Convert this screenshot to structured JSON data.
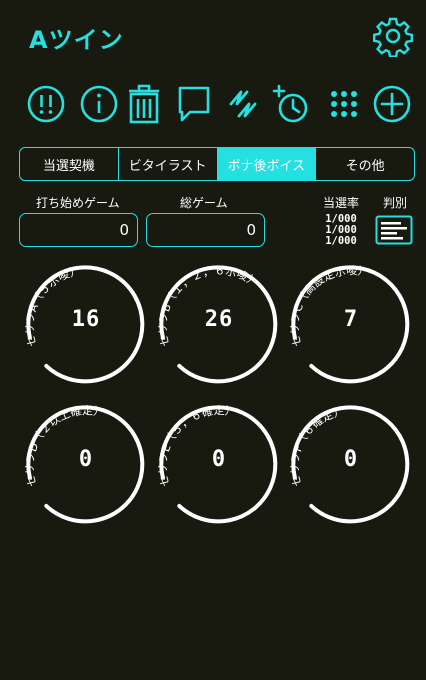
{
  "app": {
    "title": "Aツイン"
  },
  "theme": {
    "accent": "#24e0e0",
    "background": "#18190f",
    "text": "#ffffff"
  },
  "toolbar": {
    "icons": [
      "alert-icon",
      "info-icon",
      "trash-icon",
      "comment-icon",
      "lightning-icon",
      "timer-add-icon",
      "grid-icon",
      "plus-icon"
    ]
  },
  "tabs": [
    {
      "label": "当選契機",
      "active": false
    },
    {
      "label": "ビタイラスト",
      "active": false
    },
    {
      "label": "ボナ後ボイス",
      "active": true
    },
    {
      "label": "その他",
      "active": false
    }
  ],
  "inputs": {
    "start_game": {
      "label": "打ち始めゲーム",
      "value": "0"
    },
    "total_game": {
      "label": "総ゲーム",
      "value": "0"
    }
  },
  "stats": {
    "rate_label": "当選率",
    "rates": [
      "1/000",
      "1/000",
      "1/000"
    ],
    "judge_label": "判別"
  },
  "counters": [
    {
      "label": "セリフA（５示唆）",
      "value": "16"
    },
    {
      "label": "セリフB（１，２，６示唆）",
      "value": "26"
    },
    {
      "label": "セリフC（高設定示唆）",
      "value": "7"
    },
    {
      "label": "セリフD（２以上確定）",
      "value": "0"
    },
    {
      "label": "セリフE（５，６確定）",
      "value": "0"
    },
    {
      "label": "セリフF（６確定）",
      "value": "0"
    }
  ]
}
